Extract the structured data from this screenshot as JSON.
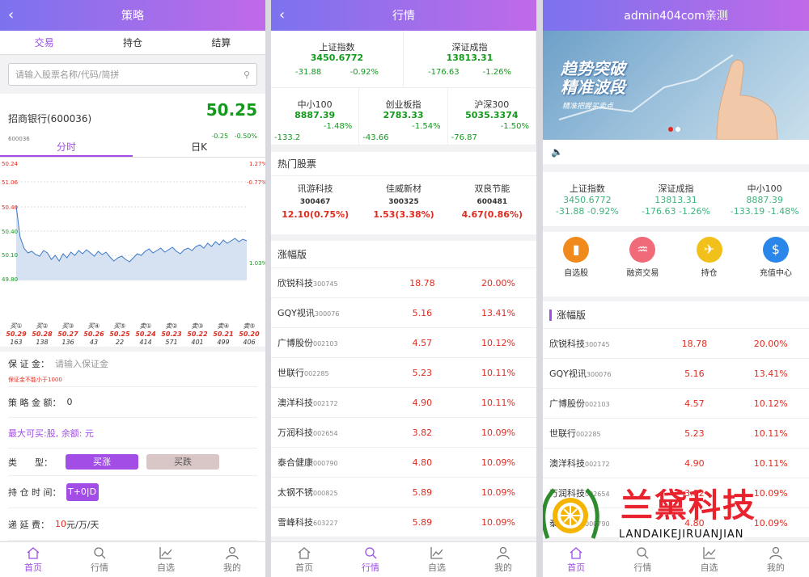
{
  "p1": {
    "title": "策略",
    "back": "‹",
    "tabs": [
      "交易",
      "持仓",
      "结算"
    ],
    "search_placeholder": "请输入股票名称/代码/简拼",
    "stock_name": "招商银行(600036)",
    "stock_code": "600036",
    "price": "50.25",
    "change": "-0.25",
    "change_pct": "-0.50%",
    "chart_tabs": [
      "分时",
      "日K"
    ],
    "left_axis": [
      "50.24",
      "51.06",
      "50.40",
      "50.40",
      "50.10",
      "49.80"
    ],
    "right_axis": [
      "1.27%",
      "-0.77%",
      "1.03%"
    ],
    "ticks": [
      {
        "l": "买①",
        "p": "50.29",
        "v": "163"
      },
      {
        "l": "买②",
        "p": "50.28",
        "v": "138"
      },
      {
        "l": "买③",
        "p": "50.27",
        "v": "136"
      },
      {
        "l": "买④",
        "p": "50.26",
        "v": "43"
      },
      {
        "l": "买⑤",
        "p": "50.25",
        "v": "22"
      },
      {
        "l": "卖①",
        "p": "50.24",
        "v": "414"
      },
      {
        "l": "卖②",
        "p": "50.23",
        "v": "571"
      },
      {
        "l": "卖③",
        "p": "50.22",
        "v": "401"
      },
      {
        "l": "卖④",
        "p": "50.21",
        "v": "499"
      },
      {
        "l": "卖⑤",
        "p": "50.20",
        "v": "406"
      }
    ],
    "margin_label": "保 证 金：",
    "margin_placeholder": "请输入保证金",
    "margin_warn": "保证金不能小于1000",
    "amount_label": "策 略 金 额：",
    "amount_value": "0",
    "max_buy": "最大可买:股, 余额: 元",
    "dir_label": "类　　型：",
    "buy_up": "买涨",
    "buy_down": "买跌",
    "hold_label": "持 仓 时 间：",
    "hold_value": "T+0|D",
    "fee_label": "递 延 费：",
    "fee_value": "10",
    "fee_unit": "元/万/天"
  },
  "p2": {
    "title": "行情",
    "back": "‹",
    "indices_row1": [
      {
        "name": "上证指数",
        "val": "3450.6772",
        "chg": "-31.88",
        "pct": "-0.92%"
      },
      {
        "name": "深证成指",
        "val": "13813.31",
        "chg": "-176.63",
        "pct": "-1.26%"
      }
    ],
    "indices_row2": [
      {
        "name": "中小100",
        "val": "8887.39",
        "chg": "-133.2",
        "pct": "-1.48%"
      },
      {
        "name": "创业板指",
        "val": "2783.33",
        "chg": "-43.66",
        "pct": "-1.54%"
      },
      {
        "name": "沪深300",
        "val": "5035.3374",
        "chg": "-76.87",
        "pct": "-1.50%"
      }
    ],
    "hot_title": "热门股票",
    "hot": [
      {
        "name": "讯游科技",
        "code": "300467",
        "val": "12.10(0.75%)"
      },
      {
        "name": "佳威新材",
        "code": "300325",
        "val": "1.53(3.38%)"
      },
      {
        "name": "双良节能",
        "code": "600481",
        "val": "4.67(0.86%)"
      }
    ],
    "rise_title": "涨幅版",
    "list": [
      {
        "n": "欣锐科技",
        "c": "300745",
        "p": "18.78",
        "r": "20.00%"
      },
      {
        "n": "GQY视讯",
        "c": "300076",
        "p": "5.16",
        "r": "13.41%"
      },
      {
        "n": "广博股份",
        "c": "002103",
        "p": "4.57",
        "r": "10.12%"
      },
      {
        "n": "世联行",
        "c": "002285",
        "p": "5.23",
        "r": "10.11%"
      },
      {
        "n": "澳洋科技",
        "c": "002172",
        "p": "4.90",
        "r": "10.11%"
      },
      {
        "n": "万润科技",
        "c": "002654",
        "p": "3.82",
        "r": "10.09%"
      },
      {
        "n": "泰合健康",
        "c": "000790",
        "p": "4.80",
        "r": "10.09%"
      },
      {
        "n": "太钢不锈",
        "c": "000825",
        "p": "5.89",
        "r": "10.09%"
      },
      {
        "n": "雪峰科技",
        "c": "603227",
        "p": "5.89",
        "r": "10.09%"
      }
    ]
  },
  "p3": {
    "title": "admin404com亲测",
    "banner_line1": "趋势突破",
    "banner_line2": "精准波段",
    "banner_sub": "精准把握买卖点",
    "indices": [
      {
        "name": "上证指数",
        "val": "3450.6772",
        "chg": "-31.88",
        "pct": "-0.92%"
      },
      {
        "name": "深证成指",
        "val": "13813.31",
        "chg": "-176.63",
        "pct": "-1.26%"
      },
      {
        "name": "中小100",
        "val": "8887.39",
        "chg": "-133.19",
        "pct": "-1.48%"
      }
    ],
    "icons": [
      {
        "label": "自选股",
        "color": "#f08a1c",
        "glyph": "▮"
      },
      {
        "label": "融资交易",
        "color": "#f06a7a",
        "glyph": "♒"
      },
      {
        "label": "持仓",
        "color": "#f2c01b",
        "glyph": "✈"
      },
      {
        "label": "充值中心",
        "color": "#2a86e8",
        "glyph": "$"
      }
    ],
    "rise_title": "涨幅版",
    "list": [
      {
        "n": "欣锐科技",
        "c": "300745",
        "p": "18.78",
        "r": "20.00%"
      },
      {
        "n": "GQY视讯",
        "c": "300076",
        "p": "5.16",
        "r": "13.41%"
      },
      {
        "n": "广博股份",
        "c": "002103",
        "p": "4.57",
        "r": "10.12%"
      },
      {
        "n": "世联行",
        "c": "002285",
        "p": "5.23",
        "r": "10.11%"
      },
      {
        "n": "澳洋科技",
        "c": "002172",
        "p": "4.90",
        "r": "10.11%"
      },
      {
        "n": "万润科技",
        "c": "002654",
        "p": "3.82",
        "r": "10.09%"
      },
      {
        "n": "泰合健康",
        "c": "000790",
        "p": "4.80",
        "r": "10.09%"
      }
    ],
    "watermark_cn": "兰黛科技",
    "watermark_en": "LANDAIKEJIRUANJIAN"
  },
  "tabbar": [
    "首页",
    "行情",
    "自选",
    "我的"
  ]
}
